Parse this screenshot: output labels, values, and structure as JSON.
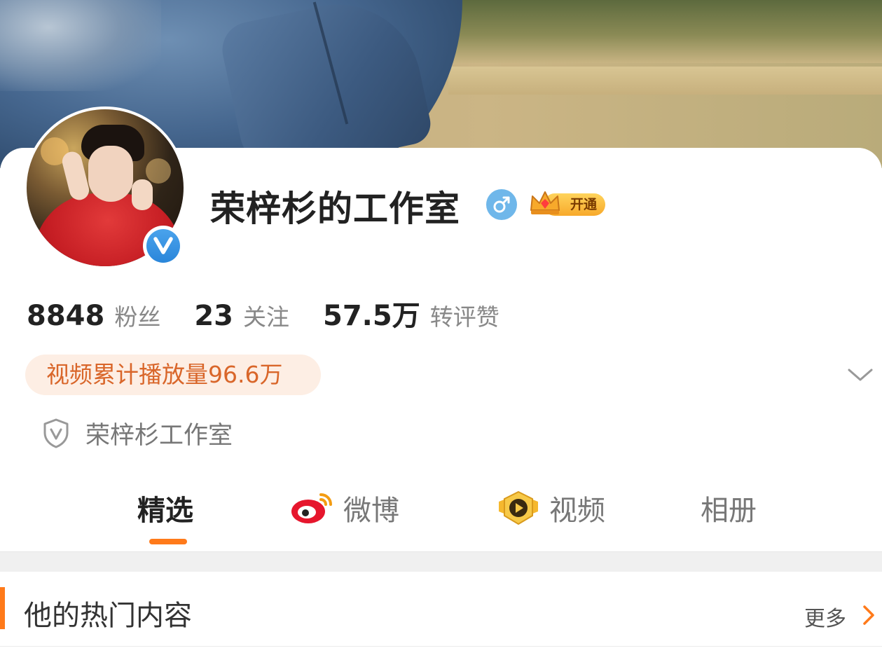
{
  "profile": {
    "name": "荣梓杉的工作室",
    "gender_symbol": "♂",
    "vip_label": "开通"
  },
  "stats": [
    {
      "value": "8848",
      "label": "粉丝"
    },
    {
      "value": "23",
      "label": "关注"
    },
    {
      "value": "57.5万",
      "label": "转评赞"
    }
  ],
  "video_play_total": "视频累计播放量96.6万",
  "verification": {
    "text": "荣梓杉工作室"
  },
  "tabs": [
    {
      "label": "精选",
      "active": true
    },
    {
      "label": "微博",
      "active": false
    },
    {
      "label": "视频",
      "active": false
    },
    {
      "label": "相册",
      "active": false
    }
  ],
  "section": {
    "title": "他的热门内容",
    "more_label": "更多"
  },
  "colors": {
    "accent": "#ff7a1a",
    "verified_blue": "#2a86da",
    "gender_blue": "#6fb7ea",
    "play_text": "#d9662a",
    "play_bg": "#fdeee4"
  },
  "icons": {
    "verified": "verified-v-icon",
    "gender": "male-icon",
    "vip": "crown-icon",
    "expand": "chevron-down-icon",
    "shield": "shield-v-icon",
    "weibo": "weibo-logo-icon",
    "video": "video-play-badge-icon",
    "more": "chevron-right-icon"
  }
}
